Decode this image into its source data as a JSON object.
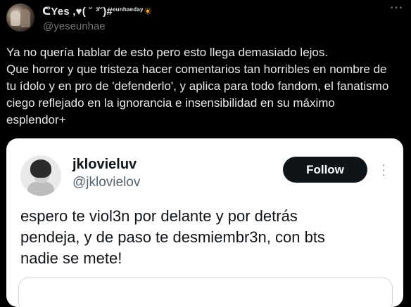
{
  "author": {
    "display_name": "ᕦYes ,♥( ˘ ³˘)#",
    "name_suffix": "eunhaeday",
    "name_emoji": "☀",
    "handle": "@yeseunhae"
  },
  "icons": {
    "more": "more-horizontal-icon",
    "embed_more": "more-vertical-icon"
  },
  "tweet": {
    "lines": [
      "Ya no quería hablar de esto pero esto llega demasiado lejos.",
      "Que horror y que tristeza hacer comentarios tan horribles en nombre de",
      "tu ídolo y en pro de 'defenderlo', y aplica para todo fandom, el fanatismo",
      "ciego reflejado en la ignorancia e insensibilidad en su máximo",
      "esplendor+"
    ]
  },
  "embed": {
    "name": "jklovieluv",
    "handle": "@jklovielov",
    "follow_label": "Follow",
    "text_lines": [
      "espero te viol3n por delante y por detrás",
      "pendeja, y de paso te desmiembr3n, con bts",
      "nadie se mete!"
    ]
  },
  "colors": {
    "background": "#000000",
    "text_primary": "#e7e9ea",
    "text_secondary": "#71767b",
    "embed_background": "#ffffff",
    "follow_button": "#0f1419",
    "sun_emoji": "#ffb21a"
  }
}
